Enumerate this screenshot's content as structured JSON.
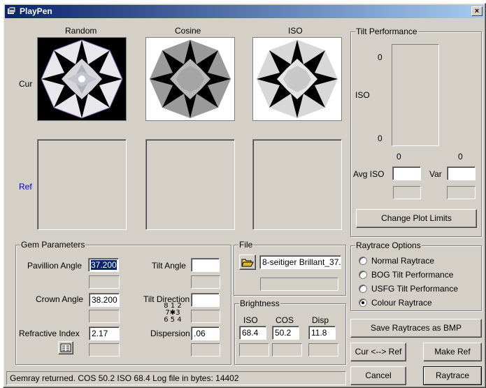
{
  "window": {
    "title": "PlayPen",
    "close_glyph": "×"
  },
  "views": {
    "random_label": "Random",
    "cosine_label": "Cosine",
    "iso_label": "ISO",
    "cur_label": "Cur",
    "ref_label": "Ref"
  },
  "tilt": {
    "group_label": "Tilt Performance",
    "y_top": "0",
    "y_axis_label": "ISO",
    "y_bottom": "0",
    "x_left": "0",
    "x_right": "0",
    "avg_iso_label": "Avg ISO",
    "avg_iso_value": "",
    "var_label": "Var",
    "var_value": "",
    "change_plot_label": "Change Plot Limits"
  },
  "gem": {
    "group_label": "Gem Parameters",
    "pavillion_label": "Pavillion Angle",
    "pavillion_value": "37.200",
    "crown_label": "Crown Angle",
    "crown_value": "38.200",
    "refractive_label": "Refractive Index",
    "refractive_value": "2.17",
    "tilt_angle_label": "Tilt Angle",
    "tilt_angle_value": "",
    "tilt_direction_label": "Tilt Direction",
    "tilt_direction_value": "",
    "compass_row1": "8 1 2",
    "compass_row2_left": "7",
    "compass_row2_right": "3",
    "compass_row3": "6 5 4",
    "dispersion_label": "Dispersion",
    "dispersion_value": ".06"
  },
  "file": {
    "group_label": "File",
    "filename": "8-seitiger Brillant_37."
  },
  "brightness": {
    "group_label": "Brightness",
    "iso_label": "ISO",
    "cos_label": "COS",
    "disp_label": "Disp",
    "iso_value": "68.4",
    "cos_value": "50.2",
    "disp_value": "11.8"
  },
  "raytrace": {
    "group_label": "Raytrace Options",
    "options": [
      {
        "label": "Normal Raytrace",
        "selected": false
      },
      {
        "label": "BOG Tilt Performance",
        "selected": false
      },
      {
        "label": "USFG Tilt Performance",
        "selected": false
      },
      {
        "label": "Colour Raytrace",
        "selected": true
      }
    ]
  },
  "buttons": {
    "save_bmp": "Save Raytraces as BMP",
    "cur_ref": "Cur <--> Ref",
    "make_ref": "Make Ref",
    "cancel": "Cancel",
    "raytrace": "Raytrace"
  },
  "status": {
    "message": "Gemray returned.   COS  50.2   ISO  68.4   Log file in bytes:  14402"
  },
  "colors": {
    "titlebar_start": "#0a246a",
    "titlebar_end": "#a6caf0",
    "face": "#d4d0c8",
    "ref_label": "#0000cc",
    "selection": "#0a246a"
  }
}
